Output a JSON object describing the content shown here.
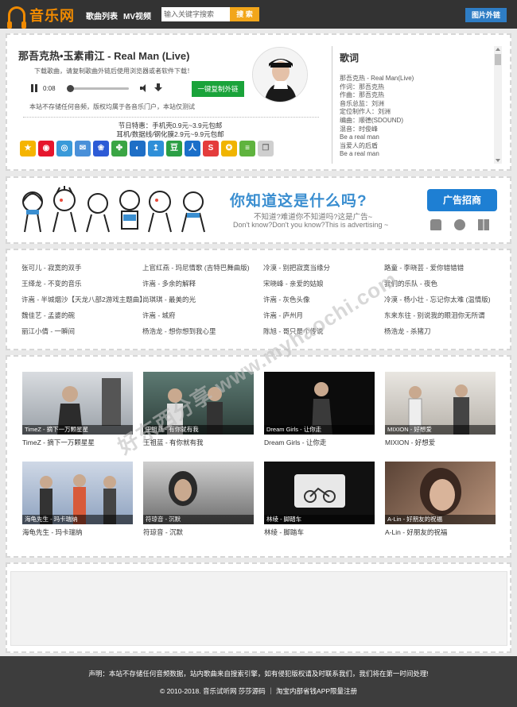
{
  "header": {
    "logo_text": "音乐网",
    "nav": [
      "歌曲列表",
      "MV视频"
    ],
    "search": {
      "placeholder": "输入关键字搜索",
      "button": "搜 索"
    },
    "image_link_button": "图片外链"
  },
  "player": {
    "title": "那吾克热•玉素甫江 - Real Man (Live)",
    "download_tip": "下载歌曲，请复制歌曲外链后使用浏览器或者软件下载！",
    "time": "0:08",
    "progress": 0.05,
    "copy_button": "一键复制外链",
    "notice": "本站不存储任何音频，版权均属于各音乐门户，本站仅测试",
    "promo": [
      "节日特惠：手机壳0.9元~3.9元包邮",
      "耳机/数据线/钢化膜2.9元~9.9元包邮"
    ],
    "share_icons": [
      "qzone-icon",
      "weibo-icon",
      "tencent-weibo-icon",
      "mail-icon",
      "baidu-icon",
      "kaixin-icon",
      "renren-icon",
      "share-icon",
      "douban-icon",
      "renren-people-icon",
      "sohu-icon",
      "star-icon",
      "feed-icon",
      "copy-icon"
    ]
  },
  "lyrics": {
    "heading": "歌词",
    "lines": [
      "那吾克热 - Real Man(Live)",
      "作词：那吾克热",
      "作曲：那吾克热",
      "音乐总监：刘洲",
      "定位制作人：刘洲",
      "编曲：顺德(SDOUND)",
      "混音：时俊峰",
      "Be a real man",
      "当爱人的后盾",
      "Be a real man"
    ]
  },
  "ad": {
    "headline": "你知道这是什么吗?",
    "sub_cn": "不知道?难道你不知道吗?这是广告~",
    "sub_en": "Don't know?Don't you know?This is advertising ~",
    "button": "广告招商"
  },
  "songs": [
    "张可儿 - 寂寞的双手",
    "上官红燕 - 玛尼情歌 (吉特巴舞曲版)",
    "冷漠 - 别把寂寞当缘分",
    "路童 - 李晓芸 - 爱你错错错",
    "王绎龙 - 不变的音乐",
    "许嵩 - 多余的解释",
    "宋晓峰 - 亲爱的姑娘",
    "我们的乐队 - 夜色",
    "许嵩 - 半城烟沙【天龙八部2游戏主题曲】",
    "尚琪琪 - 最美的光",
    "许嵩 - 灰色头像",
    "冷漠 - 杨小壮 - 忘记你太难 (温情版)",
    "魏佳艺 - 孟婆的碗",
    "许嵩 - 城府",
    "许嵩 - 庐州月",
    "东来东往 - 别说我的眼泪你无所谓",
    "丽江小倩 - 一瞬间",
    "杨浩龙 - 想你想到我心里",
    "陈旭 - 哥只是个传说",
    "杨浩龙 - 杀猪刀"
  ],
  "mvs": [
    {
      "caption": "TimeZ - 摘下一万颗星星",
      "title": "TimeZ - 摘下一万颗星星"
    },
    {
      "caption": "王祖蓝 - 有你就有我",
      "title": "王祖蓝 - 有你就有我"
    },
    {
      "caption": "Dream Girls - 让你走",
      "title": "Dream Girls - 让你走"
    },
    {
      "caption": "MIXION - 好想爱",
      "title": "MIXION - 好想爱"
    },
    {
      "caption": "海龟先生 - 玛卡瑞纳",
      "title": "海龟先生 - 玛卡瑞纳"
    },
    {
      "caption": "符琼音 - 沉默",
      "title": "符琼音 - 沉默"
    },
    {
      "caption": "林绫 - 脚踏车",
      "title": "林绫 - 脚踏车"
    },
    {
      "caption": "A-Lin - 好朋友的祝福",
      "title": "A-Lin - 好朋友的祝福"
    }
  ],
  "footer": {
    "statement": "声明：本站不存储任何音频数据，站内歌曲来自搜索引擎，如有侵犯版权请及时联系我们，我们将在第一时间处理!",
    "copyright": "© 2010-2018. 音乐试听网 莎莎源码 ｜ 淘宝内部省钱APP限量注册"
  },
  "watermark": "好东西分享 www.myhaochi.com"
}
